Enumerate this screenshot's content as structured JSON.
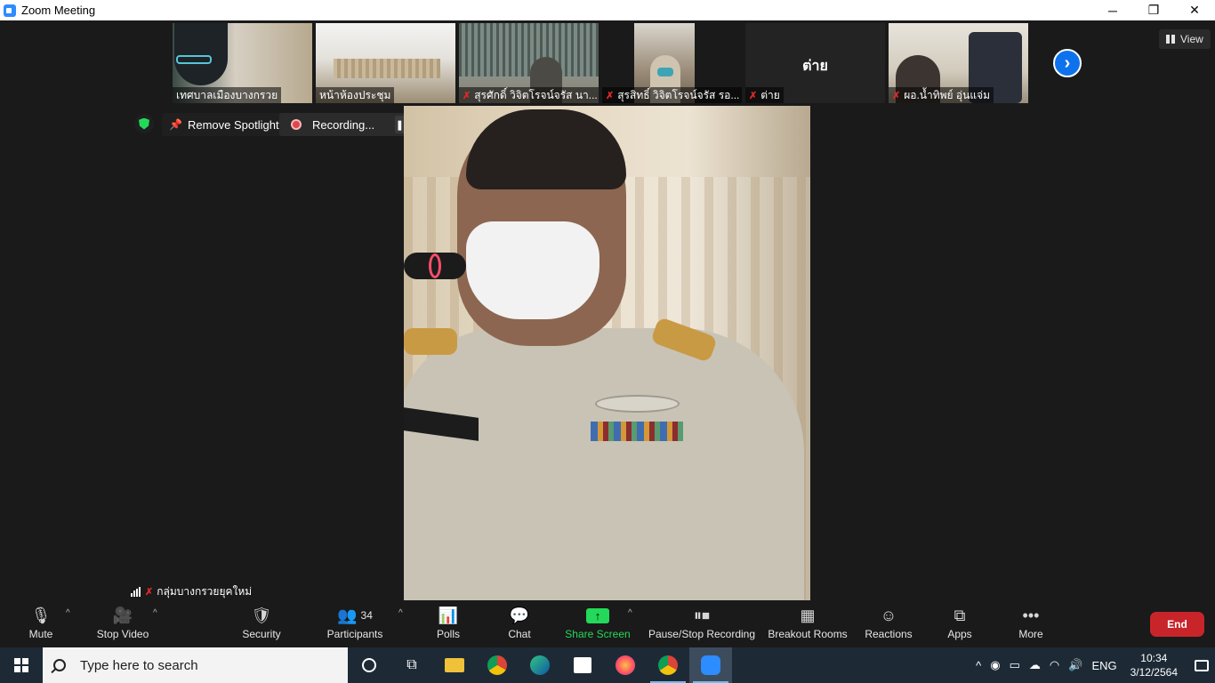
{
  "window": {
    "title": "Zoom Meeting",
    "minimize": "─",
    "restore": "❐",
    "close": "✕"
  },
  "view_button": {
    "label": "View"
  },
  "thumbnails": [
    {
      "name": "เทศบาลเมืองบางกรวย",
      "muted": false
    },
    {
      "name": "หน้าห้องประชุม",
      "muted": false
    },
    {
      "name": "สุรศักดิ์ วิจิตโรจน์จรัส นา...",
      "muted": true
    },
    {
      "name": "สุรสิทธิ์ วิจิตโรจน์จรัส รอ...",
      "muted": true
    },
    {
      "name": "ต่าย",
      "muted": true,
      "display_text": "ต่าย"
    },
    {
      "name": "ผอ.น้ำทิพย์ อุ่นแจ่ม",
      "muted": true
    }
  ],
  "next_page_icon": "chevron-right-icon",
  "spotlight": {
    "label": "Remove Spotlight"
  },
  "recording": {
    "label": "Recording...",
    "pause": "❚❚",
    "stop": "■"
  },
  "active_speaker": {
    "name": "กลุ่มบางกรวยยุคใหม่"
  },
  "toolbar": {
    "mute": "Mute",
    "stop_video": "Stop Video",
    "security": "Security",
    "participants": "Participants",
    "participants_count": "34",
    "polls": "Polls",
    "chat": "Chat",
    "share_screen": "Share Screen",
    "pause_stop_recording": "Pause/Stop Recording",
    "breakout_rooms": "Breakout Rooms",
    "reactions": "Reactions",
    "apps": "Apps",
    "more": "More",
    "end": "End",
    "caret": "^"
  },
  "taskbar": {
    "search_placeholder": "Type here to search",
    "language": "ENG",
    "time": "10:34",
    "date": "3/12/2564"
  },
  "colors": {
    "accent": "#0e72ed",
    "share_green": "#23d959",
    "end_red": "#c8252b",
    "mic_off_red": "#e02828"
  }
}
